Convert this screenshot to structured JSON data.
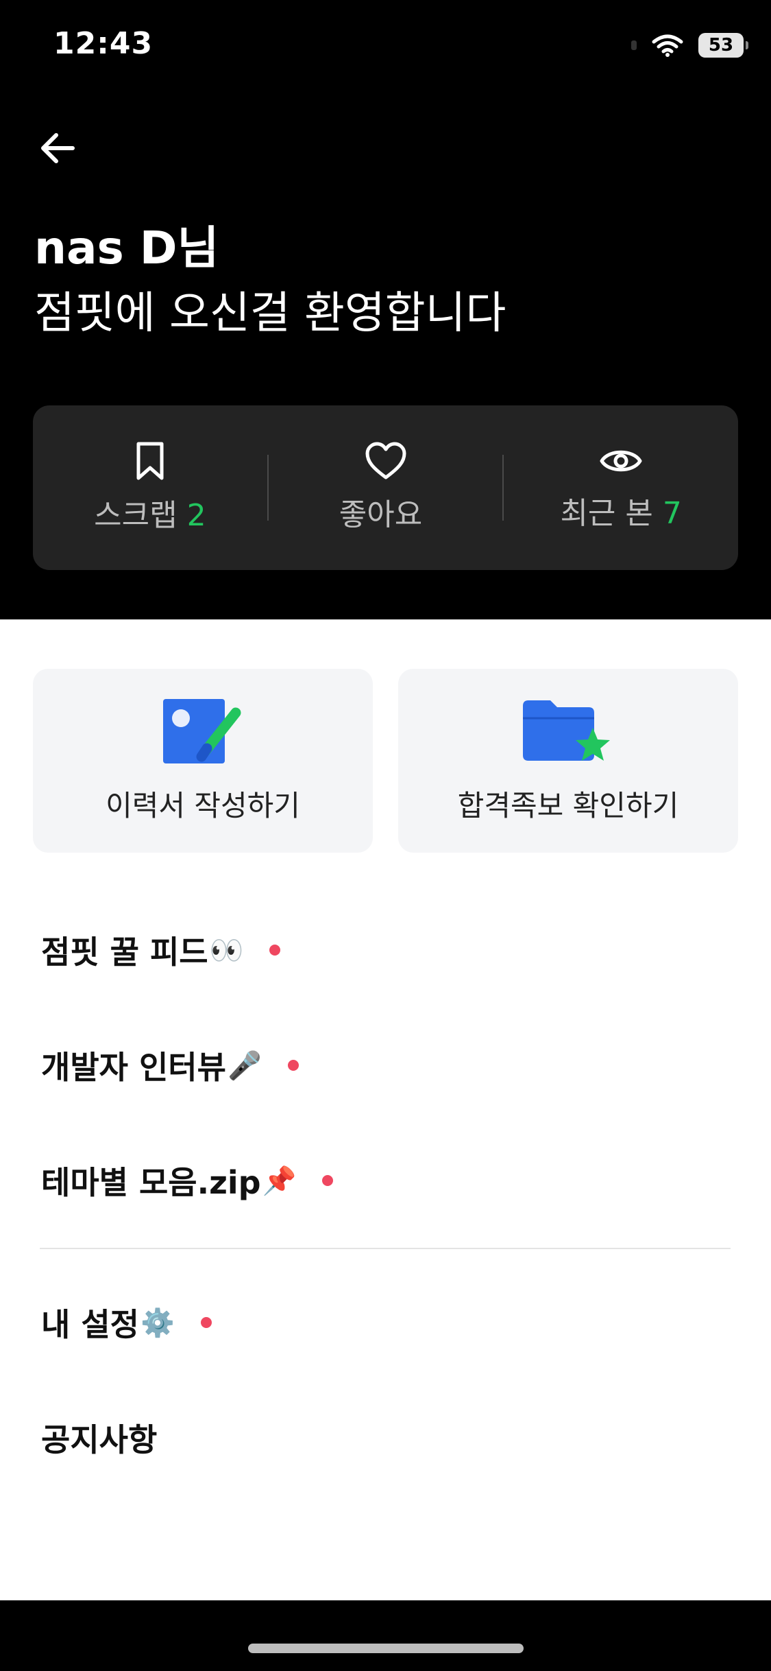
{
  "status_bar": {
    "time": "12:43",
    "battery": "53"
  },
  "header": {
    "name": "nas D님",
    "subtitle": "점핏에 오신걸 환영합니다"
  },
  "stats": [
    {
      "label": "스크랩",
      "count": "2",
      "icon": "bookmark-icon"
    },
    {
      "label": "좋아요",
      "count": "",
      "icon": "heart-icon"
    },
    {
      "label": "최근 본",
      "count": "7",
      "icon": "eye-icon"
    }
  ],
  "actions": [
    {
      "label": "이력서 작성하기",
      "icon": "resume-edit-icon"
    },
    {
      "label": "합격족보 확인하기",
      "icon": "star-folder-icon"
    }
  ],
  "menu": [
    {
      "label": "점핏 꿀 피드",
      "emoji": "👀",
      "new": true
    },
    {
      "label": "개발자 인터뷰",
      "emoji": "🎤",
      "new": true
    },
    {
      "label": "테마별 모음.zip",
      "emoji": "📌",
      "new": true
    },
    {
      "label": "내 설정",
      "emoji": "⚙️",
      "new": true
    },
    {
      "label": "공지사항",
      "emoji": "",
      "new": false
    }
  ],
  "colors": {
    "accent_green": "#22c55e",
    "new_dot": "#ef4760",
    "icon_blue": "#2f6fea"
  }
}
